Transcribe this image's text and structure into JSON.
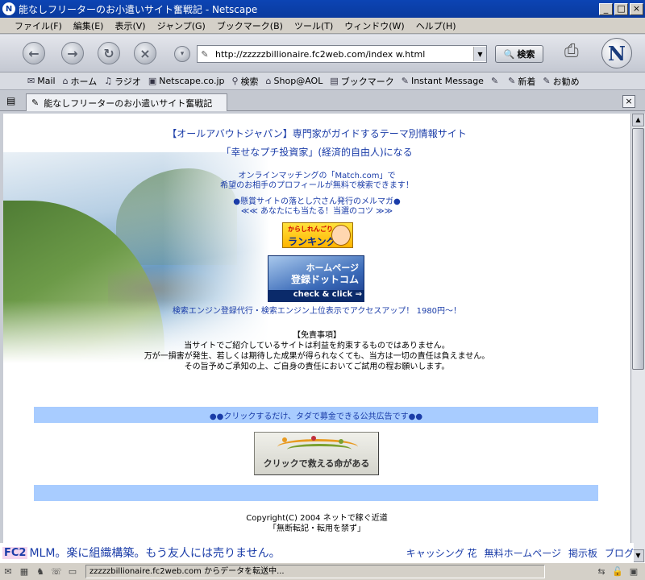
{
  "window": {
    "title": "能なしフリーターのお小遣いサイト奮戦記 - Netscape",
    "app_icon_letter": "N",
    "min_glyph": "_",
    "max_glyph": "□",
    "close_glyph": "×"
  },
  "menu": [
    "ファイル(F)",
    "編集(E)",
    "表示(V)",
    "ジャンプ(G)",
    "ブックマーク(B)",
    "ツール(T)",
    "ウィンドウ(W)",
    "ヘルプ(H)"
  ],
  "nav": {
    "back_glyph": "←",
    "forward_glyph": "→",
    "reload_glyph": "↻",
    "stop_glyph": "×",
    "url": "http://zzzzzbillionaire.fc2web.com/index w.html",
    "search_label": "検索",
    "logo_letter": "N"
  },
  "personal_toolbar": [
    {
      "icon": "mail-icon",
      "label": "Mail"
    },
    {
      "icon": "home-icon",
      "label": "ホーム"
    },
    {
      "icon": "radio-icon",
      "label": "ラジオ"
    },
    {
      "icon": "my-icon",
      "label": "Netscape.co.jp"
    },
    {
      "icon": "search-icon",
      "label": "検索"
    },
    {
      "icon": "shop-icon",
      "label": "Shop@AOL"
    },
    {
      "icon": "bookmark-icon",
      "label": "ブックマーク"
    },
    {
      "icon": "link-icon",
      "label": "Instant Message"
    },
    {
      "icon": "link-icon",
      "label": ""
    },
    {
      "icon": "link-icon",
      "label": "新着"
    },
    {
      "icon": "link-icon",
      "label": "お勧め"
    }
  ],
  "tab": {
    "title": "能なしフリーターのお小遣いサイト奮戦記",
    "close_glyph": "×"
  },
  "page": {
    "link_allabout": "【オールアバウトジャパン】専門家がガイドするテーマ別情報サイト",
    "link_petit": "「幸せなプチ投資家」(経済的自由人)になる",
    "match_line1": "オンラインマッチングの「Match.com」で",
    "match_line2": "希望のお相手のプロフィールが無料で検索できます！",
    "mag_line1": "●懸賞サイトの落とし穴さん発行のメルマガ●",
    "mag_line2": "≪≪ あなたにも当たる！当選のコツ ≫≫",
    "rank_banner_top": "からしれんごり",
    "rank_banner_main": "ランキング",
    "reg_banner_l1": "ホームページ",
    "reg_banner_l2": "登録ドットコム",
    "reg_banner_l3": "check & click ⇒",
    "seo_line": "検索エンジン登録代行・検索エンジン上位表示でアクセスアップ！ 1980円～！",
    "disclaimer_title": "【免責事項】",
    "disclaimer_1": "当サイトでご紹介しているサイトは利益を約束するものではありません。",
    "disclaimer_2": "万が一損害が発生、若しくは期待した成果が得られなくても、当方は一切の責任は負えません。",
    "disclaimer_3": "その旨予めご承知の上、ご自身の責任においてご試用の程お願いします。",
    "band_text": "●●クリックするだけ、タダで募金できる公共広告です●●",
    "charity_label": "クリックで救える命がある",
    "copyright": "Copyright(C) 2004 ネットで稼ぐ近道",
    "no_copy": "「無断転記・転用を禁ず」"
  },
  "adline": {
    "fc2": "FC2",
    "message": "MLM。楽に組織構築。もう友人には売りません。",
    "links": [
      "キャッシング 花",
      "無料ホームページ",
      "掲示板",
      "ブログ"
    ]
  },
  "status": {
    "text": "zzzzzbillionaire.fc2web.com からデータを転送中..."
  },
  "colors": {
    "link_blue": "#1a3ca8",
    "band_blue": "#a8ccff",
    "titlebar_blue": "#0c44b4"
  }
}
